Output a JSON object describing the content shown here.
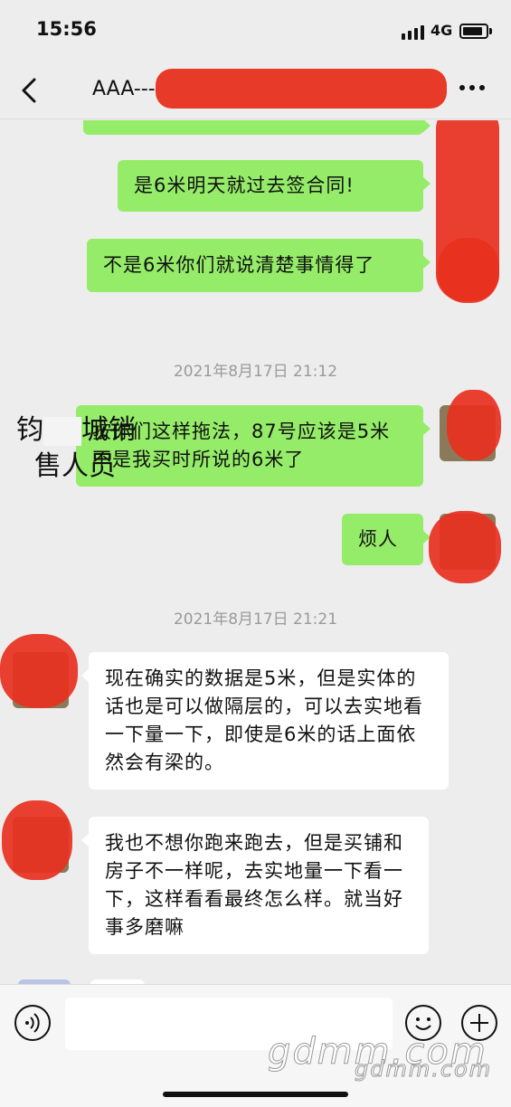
{
  "status_bar": {
    "time": "15:56",
    "network": "4G",
    "battery_level": 0.75
  },
  "header": {
    "title": "AAA---"
  },
  "messages": [
    {
      "text": "是6米明天就过去签合同!"
    },
    {
      "text": "不是6米你们就说清楚事情得了"
    },
    {
      "timestamp": "2021年8月17日 21:12"
    },
    {
      "text": "按你们这样拖法，87号应该是5米不是我买时所说的6米了"
    },
    {
      "text": "烦人"
    },
    {
      "timestamp": "2021年8月17日 21:21"
    },
    {
      "text": "现在确实的数据是5米，但是实体的话也是可以做隔层的，可以去实地看一下量一下，即使是6米的话上面依然会有梁的。"
    },
    {
      "text": "我也不想你跑来跑去，但是买铺和房子不一样呢，去实地量一下看一下，这样看看最终怎么样。就当好事多磨嘛"
    }
  ],
  "annotation": {
    "line1": "钧",
    "line1b": "城销",
    "line2": "售人员"
  },
  "watermark": {
    "large": "gdmm.com",
    "small": "gdmm.com"
  },
  "colors": {
    "outgoing_bubble": "#95ec69",
    "incoming_bubble": "#ffffff",
    "background": "#ededed",
    "redaction": "#e8301f"
  },
  "icons": [
    "back-arrow-icon",
    "more-icon",
    "voice-icon",
    "emoji-icon",
    "plus-icon"
  ]
}
